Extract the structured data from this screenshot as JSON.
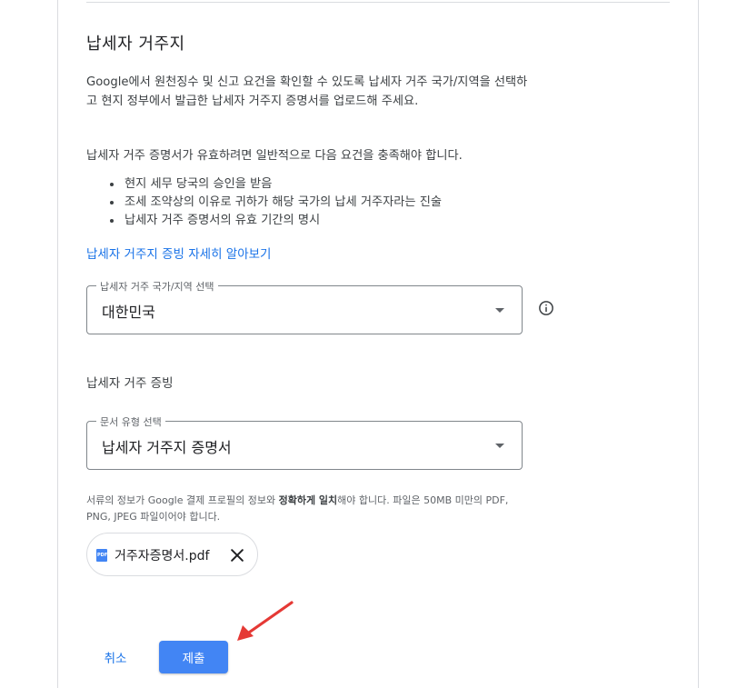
{
  "section": {
    "title": "납세자 거주지",
    "intro": "Google에서 원천징수 및 신고 요건을 확인할 수 있도록 납세자 거주 국가/지역을 선택하고 현지 정부에서 발급한 납세자 거주지 증명서를 업로드해 주세요.",
    "requirements_intro": "납세자 거주 증명서가 유효하려면 일반적으로 다음 요건을 충족해야 합니다.",
    "requirements": [
      "현지 세무 당국의 승인을 받음",
      "조세 조약상의 이유로 귀하가 해당 국가의 납세 거주자라는 진술",
      "납세자 거주 증명서의 유효 기간의 명시"
    ],
    "learn_more_link": "납세자 거주지 증빙 자세히 알아보기"
  },
  "country_select": {
    "label": "납세자 거주 국가/지역 선택",
    "value": "대한민국"
  },
  "proof": {
    "title": "납세자 거주 증빙",
    "doc_select_label": "문서 유형 선택",
    "doc_select_value": "납세자 거주지 증명서",
    "note_before": "서류의 정보가 Google 결제 프로필의 정보와 ",
    "note_bold": "정확하게 일치",
    "note_after": "해야 합니다. 파일은 50MB 미만의 PDF, PNG, JPEG 파일이어야 합니다.",
    "file_name": "거주자증명서.pdf",
    "file_type_badge": "PDF"
  },
  "actions": {
    "cancel": "취소",
    "submit": "제출"
  },
  "colors": {
    "link": "#1a73e8",
    "primary_button": "#4285f4",
    "annotation_arrow": "#e53935",
    "border": "#80868b",
    "divider": "#dadce0"
  }
}
